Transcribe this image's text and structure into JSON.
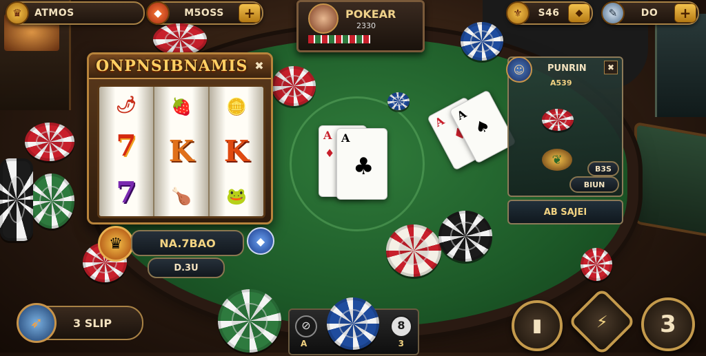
{
  "hud": {
    "player_name": "ATMOS",
    "player_icon": "crest-icon",
    "currency1": "M5OSS",
    "currency1_icon": "gem-icon",
    "currency2": "S46",
    "currency2_icon": "coin-icon",
    "currency3": "DO",
    "currency3_icon": "feather-icon"
  },
  "game_header": {
    "title": "POKEAR",
    "sub": "2330"
  },
  "slot": {
    "title": "ONPNSIBNAMIS",
    "reel_symbols": [
      [
        "🌶",
        "7",
        "7"
      ],
      [
        "🍓",
        "K",
        "🍗"
      ],
      [
        "🪙",
        "K",
        "🐸"
      ]
    ],
    "win_label": "NA.7BAO",
    "bet_label": "D.3U"
  },
  "table": {
    "center_cards": [
      {
        "rank": "A",
        "suit": "♦",
        "color": "#c8202c"
      },
      {
        "rank": "A",
        "suit": "♣",
        "color": "#111111"
      }
    ],
    "opponent_cards": [
      {
        "rank": "A",
        "suit": "♦",
        "color": "#c8202c"
      },
      {
        "rank": "A",
        "suit": "♠",
        "color": "#111111"
      }
    ]
  },
  "player_panel": {
    "name": "PUNRIN",
    "balance": "A539",
    "stack_value": "B3S",
    "pot_label": "BIUN",
    "footer": "AB SAJEI"
  },
  "bottom": {
    "bet_amount": "3 SLIP",
    "center_left": "A",
    "center_right": "3",
    "round_number": "3"
  }
}
